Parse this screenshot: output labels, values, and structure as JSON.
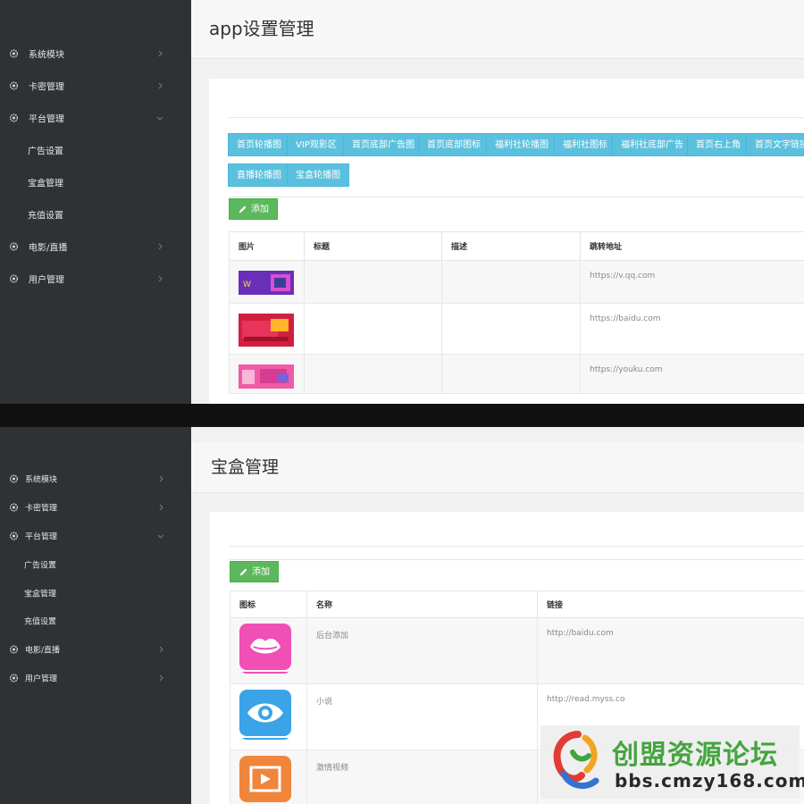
{
  "top": {
    "sidebar": [
      {
        "label": "系统模块",
        "icon": "gear-icon",
        "chevron": "right"
      },
      {
        "label": "卡密管理",
        "icon": "gear-icon",
        "chevron": "right"
      },
      {
        "label": "平台管理",
        "icon": "gear-icon",
        "chevron": "down"
      },
      {
        "label": "广告设置",
        "sub": true
      },
      {
        "label": "宝盒管理",
        "sub": true
      },
      {
        "label": "充值设置",
        "sub": true
      },
      {
        "label": "电影/直播",
        "icon": "gear-icon",
        "chevron": "right"
      },
      {
        "label": "用户管理",
        "icon": "gear-icon",
        "chevron": "right"
      }
    ],
    "title": "app设置管理",
    "tabs": [
      "首页轮播图",
      "VIP观影区",
      "首页底部广告图",
      "首页底部图标",
      "福利社轮播图",
      "福利社图标",
      "福利社底部广告",
      "首页右上角",
      "首页文字链接",
      "直播轮播图",
      "宝盒轮播图"
    ],
    "add_label": "添加",
    "table": {
      "headers": [
        "图片",
        "标题",
        "描述",
        "跳转地址"
      ],
      "rows": [
        {
          "image": "banner-ad-1",
          "title": "",
          "desc": "",
          "url": "https://v.qq.com"
        },
        {
          "image": "banner-ad-2",
          "title": "",
          "desc": "",
          "url": "https://baidu.com"
        },
        {
          "image": "banner-ad-3",
          "title": "",
          "desc": "",
          "url": "https://youku.com"
        }
      ]
    }
  },
  "bottom": {
    "sidebar": [
      {
        "label": "系统模块",
        "icon": "gear-icon",
        "chevron": "right"
      },
      {
        "label": "卡密管理",
        "icon": "gear-icon",
        "chevron": "right"
      },
      {
        "label": "平台管理",
        "icon": "gear-icon",
        "chevron": "down"
      },
      {
        "label": "广告设置",
        "sub": true
      },
      {
        "label": "宝盒管理",
        "sub": true
      },
      {
        "label": "充值设置",
        "sub": true
      },
      {
        "label": "电影/直播",
        "icon": "gear-icon",
        "chevron": "right"
      },
      {
        "label": "用户管理",
        "icon": "gear-icon",
        "chevron": "right"
      }
    ],
    "title": "宝盒管理",
    "add_label": "添加",
    "table": {
      "headers": [
        "图标",
        "名称",
        "链接"
      ],
      "rows": [
        {
          "icon": "lips-icon",
          "color": "#f04fb5",
          "name": "后台添加",
          "link": "http://baidu.com"
        },
        {
          "icon": "eye-icon",
          "color": "#3ba4e8",
          "name": "小说",
          "link": "http://read.myss.co"
        },
        {
          "icon": "film-icon",
          "color": "#f0853c",
          "name": "激情视频",
          "link": ""
        }
      ]
    }
  },
  "watermark": {
    "title": "创盟资源论坛",
    "sub": "bbs.cmzy168.com"
  },
  "colors": {
    "sidebar": "#2f3235",
    "tab": "#5bc0de",
    "add": "#5cb85c"
  }
}
